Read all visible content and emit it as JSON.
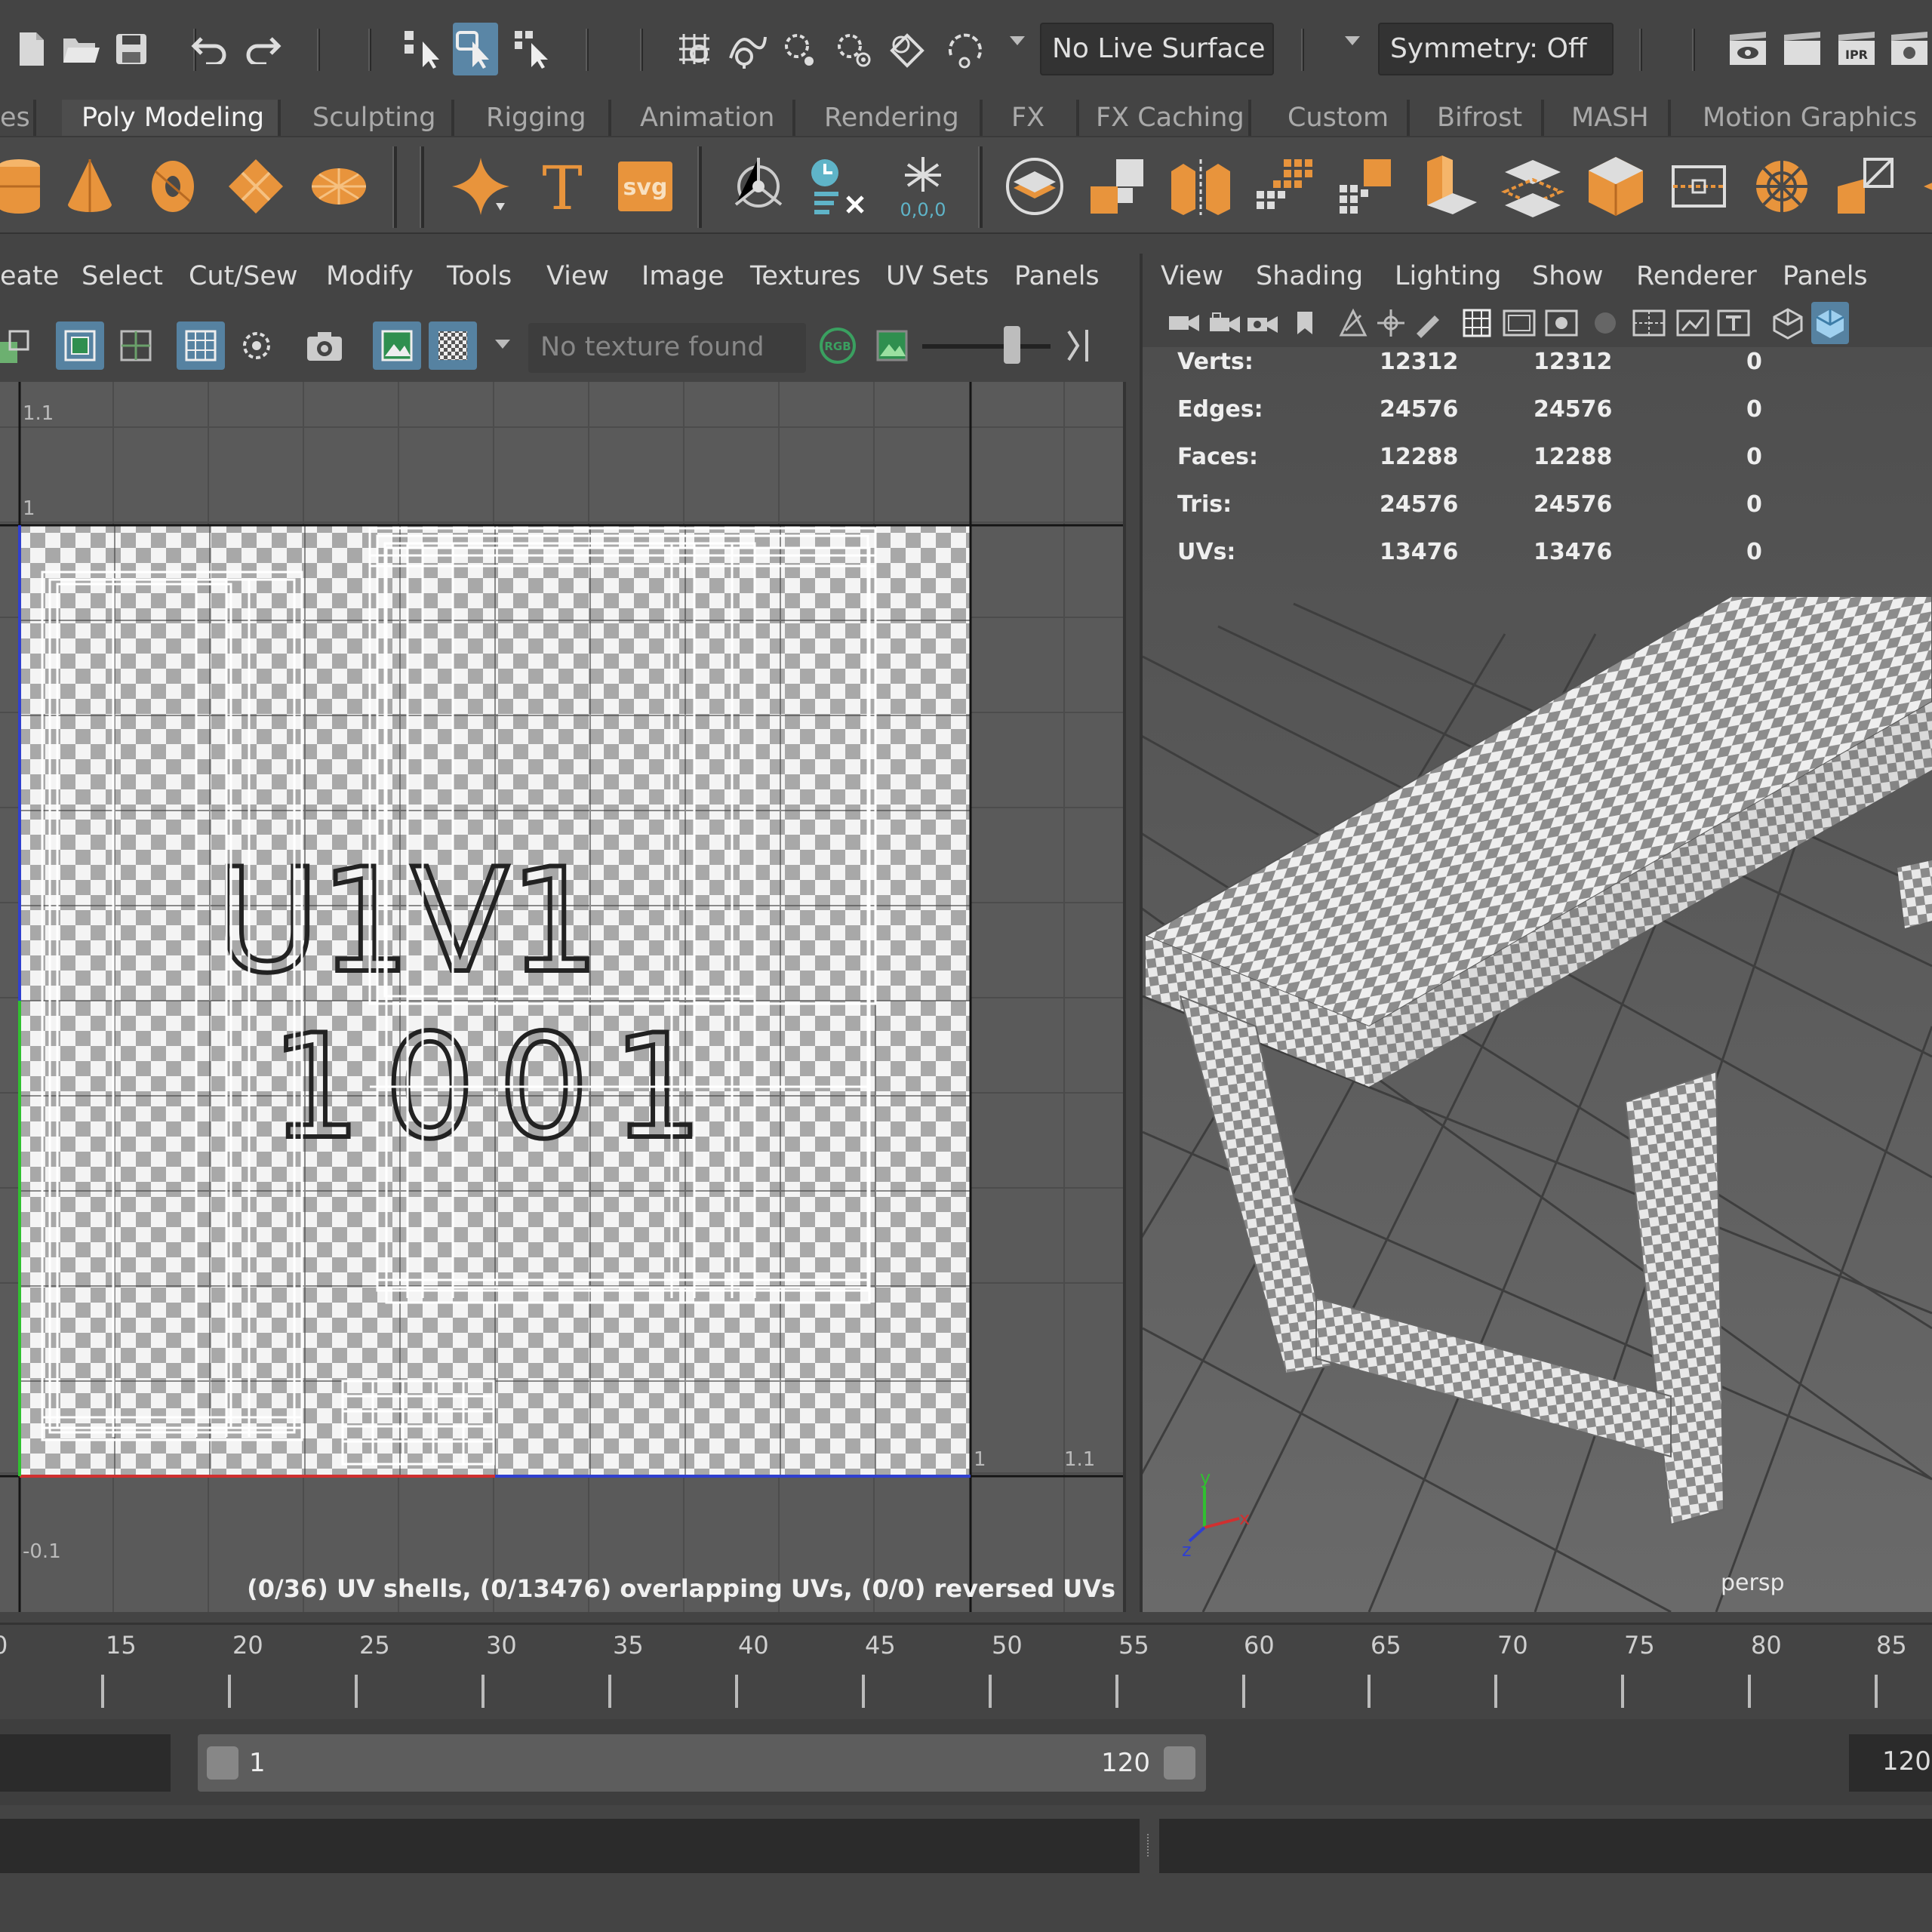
{
  "status_line": {
    "live_surface": "No Live Surface",
    "symmetry": "Symmetry: Off",
    "ipr_label": "IPR"
  },
  "shelf_tabs": [
    "es",
    "Poly Modeling",
    "Sculpting",
    "Rigging",
    "Animation",
    "Rendering",
    "FX",
    "FX Caching",
    "Custom",
    "Bifrost",
    "MASH",
    "Motion Graphics"
  ],
  "shelf": {
    "svg_label": "svg",
    "text_label": "T",
    "snowflake_coords": "0,0,0"
  },
  "uv_editor": {
    "menu": [
      "eate",
      "Select",
      "Cut/Sew",
      "Modify",
      "Tools",
      "View",
      "Image",
      "Textures",
      "UV Sets",
      "Panels"
    ],
    "texture_field": "No texture found",
    "rgb_label": "RGB",
    "axis_labels": {
      "top_v": "1.1",
      "one_v": "1",
      "bottom_v": "-0.1",
      "right_u": "1.1",
      "one_u": "1"
    },
    "tile_text": {
      "line1": "U1V1",
      "line2": "1001"
    },
    "status": "(0/36) UV shells, (0/13476) overlapping UVs, (0/0) reversed UVs"
  },
  "viewport": {
    "menu": [
      "View",
      "Shading",
      "Lighting",
      "Show",
      "Renderer",
      "Panels"
    ],
    "hud": [
      {
        "label": "Verts:",
        "a": "12312",
        "b": "12312",
        "c": "0"
      },
      {
        "label": "Edges:",
        "a": "24576",
        "b": "24576",
        "c": "0"
      },
      {
        "label": "Faces:",
        "a": "12288",
        "b": "12288",
        "c": "0"
      },
      {
        "label": "Tris:",
        "a": "24576",
        "b": "24576",
        "c": "0"
      },
      {
        "label": "UVs:",
        "a": "13476",
        "b": "13476",
        "c": "0"
      }
    ],
    "camera_label": "persp",
    "axis": {
      "y": "y",
      "x": "x",
      "z": "z"
    }
  },
  "time_slider": {
    "ticks": [
      "0",
      "15",
      "20",
      "25",
      "30",
      "35",
      "40",
      "45",
      "50",
      "55",
      "60",
      "65",
      "70",
      "75",
      "80",
      "85"
    ]
  },
  "range_slider": {
    "start": "1",
    "end": "120",
    "end_field": "120"
  },
  "colors": {
    "accent": "#f0a050",
    "active_tool": "#5a86a6",
    "panel_bg": "#444444",
    "uv_red": "#d03030",
    "uv_blue": "#3040d0",
    "uv_green": "#30c030"
  }
}
